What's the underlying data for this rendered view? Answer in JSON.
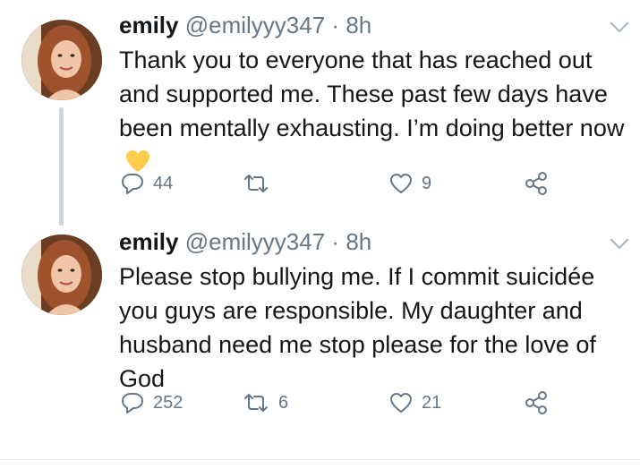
{
  "tweets": [
    {
      "name": "emily",
      "handle": "@emilyyy347",
      "separator": "·",
      "time": "8h",
      "text": "Thank you to everyone that has reached out and supported me. These past few days have been mentally exhausting. I’m doing better now",
      "emoji": "yellow-heart-icon",
      "replies": "44",
      "retweets": "",
      "likes": "9"
    },
    {
      "name": "emily",
      "handle": "@emilyyy347",
      "separator": "·",
      "time": "8h",
      "text": "Please stop bullying me. If I commit suicidée you guys are responsible. My daughter and husband need me stop please for the love of God",
      "replies": "252",
      "retweets": "6",
      "likes": "21"
    }
  ],
  "colors": {
    "text": "#14171a",
    "muted": "#657786",
    "thread_line": "#ccd6dd",
    "heart_emoji": "#ffcc4d"
  }
}
